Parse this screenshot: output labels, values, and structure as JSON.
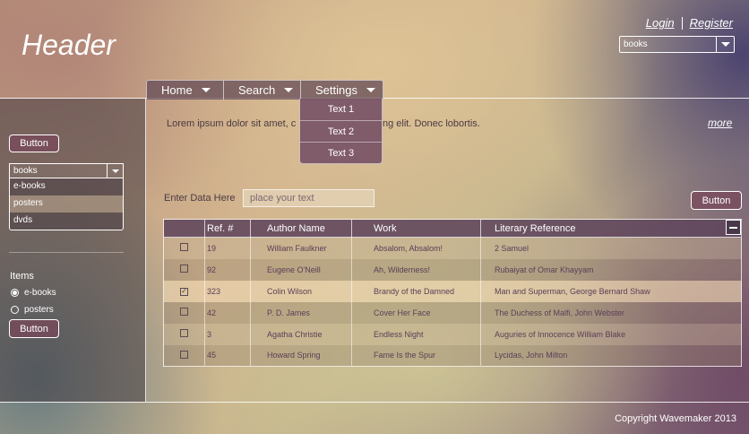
{
  "header": {
    "title": "Header",
    "login": "Login",
    "register": "Register",
    "select_value": "books"
  },
  "nav": {
    "items": [
      {
        "label": "Home"
      },
      {
        "label": "Search"
      },
      {
        "label": "Settings"
      }
    ],
    "settings_menu": [
      "Text 1",
      "Text 2",
      "Text 3"
    ]
  },
  "sidebar": {
    "button_top": "Button",
    "select_value": "books",
    "dropdown_options": [
      "e-books",
      "posters",
      "dvds"
    ],
    "items_label": "Items",
    "radios": [
      {
        "label": "e-books",
        "checked": true
      },
      {
        "label": "posters",
        "checked": false
      }
    ],
    "button_bottom": "Button"
  },
  "main": {
    "lorem_left": "Lorem ipsum dolor sit amet, c",
    "lorem_right": "ng elit. Donec lobortis.",
    "more": "more",
    "enter_label": "Enter Data Here",
    "input_placeholder": "place your text",
    "button": "Button"
  },
  "table": {
    "headers": [
      "Ref. #",
      "Author Name",
      "Work",
      "Literary Reference"
    ],
    "rows": [
      {
        "checked": false,
        "ref": "19",
        "author": "William Faulkner",
        "work": "Absalom, Absalom!",
        "reference": "2 Samuel"
      },
      {
        "checked": false,
        "ref": "92",
        "author": "Eugene O'Neill",
        "work": "Ah, Wilderness!",
        "reference": "Rubaiyat of Omar Khayyam"
      },
      {
        "checked": true,
        "ref": "323",
        "author": "Colin Wilson",
        "work": "Brandy of the Damned",
        "reference": "Man and Superman, George Bernard Shaw"
      },
      {
        "checked": false,
        "ref": "42",
        "author": "P. D. James",
        "work": "Cover Her Face",
        "reference": "The Duchess of Malfi, John Webster"
      },
      {
        "checked": false,
        "ref": "3",
        "author": "Agatha Christie",
        "work": "Endless Night",
        "reference": "Auguries of Innocence William Blake"
      },
      {
        "checked": false,
        "ref": "45",
        "author": "Howard Spring",
        "work": "Fame Is the Spur",
        "reference": "Lycidas, John Milton"
      }
    ]
  },
  "footer": {
    "copyright": "Copyright Wavemaker 2013"
  }
}
